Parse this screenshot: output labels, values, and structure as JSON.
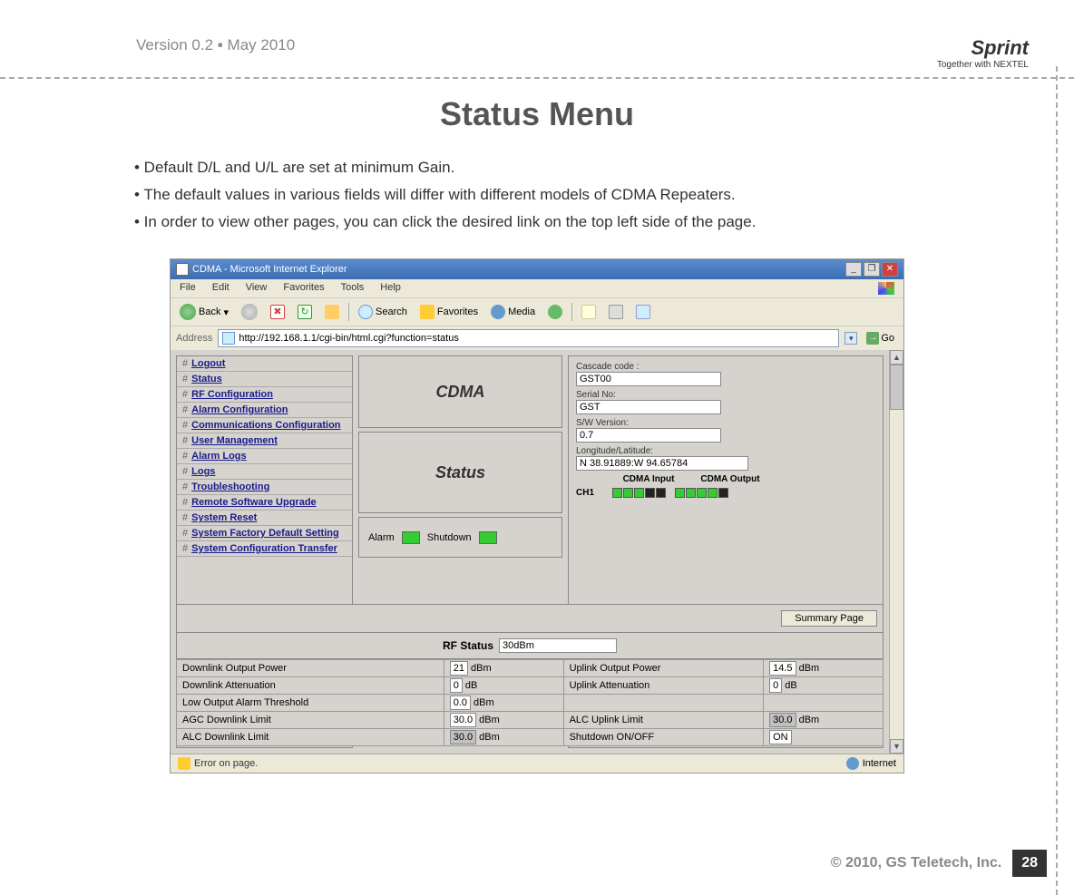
{
  "header": {
    "version": "Version 0.2 ▪ May 2010",
    "logo_main": "Sprint",
    "logo_sub": "Together with NEXTEL"
  },
  "title": "Status Menu",
  "bullets": [
    "• Default D/L and U/L are set at minimum Gain.",
    "• The default values in various fields will differ with different models of CDMA Repeaters.",
    "• In order to view other pages, you can click the desired link on the top left side of the page."
  ],
  "ie": {
    "title": "CDMA - Microsoft Internet Explorer",
    "menu": [
      "File",
      "Edit",
      "View",
      "Favorites",
      "Tools",
      "Help"
    ],
    "toolbar": {
      "back": "Back",
      "search": "Search",
      "favorites": "Favorites",
      "media": "Media"
    },
    "address_label": "Address",
    "address_url": "http://192.168.1.1/cgi-bin/html.cgi?function=status",
    "go": "Go",
    "status_left": "Error on page.",
    "status_right": "Internet"
  },
  "nav": [
    "Logout",
    "Status",
    "RF Configuration",
    "Alarm Configuration",
    "Communications Configuration",
    "User Management",
    "Alarm Logs",
    "Logs",
    "Troubleshooting",
    "Remote Software Upgrade",
    "System Reset",
    "System Factory Default Setting",
    "System Configuration Transfer"
  ],
  "mid": {
    "cdma": "CDMA",
    "status": "Status",
    "alarm_label": "Alarm",
    "shutdown_label": "Shutdown"
  },
  "info": {
    "cascade_label": "Cascade code :",
    "cascade_value": "GST00",
    "serial_label": "Serial No:",
    "serial_value": "GST",
    "sw_label": "S/W Version:",
    "sw_value": "0.7",
    "lonlat_label": "Longitude/Latitude:",
    "lonlat_value": "N 38.91889:W 94.65784",
    "cdma_input": "CDMA Input",
    "cdma_output": "CDMA Output",
    "ch1": "CH1"
  },
  "lower": {
    "summary_btn": "Summary Page",
    "rf_label": "RF Status",
    "rf_value": "30dBm",
    "rows": [
      {
        "l_label": "Downlink Output Power",
        "l_val": "21",
        "l_unit": "dBm",
        "r_label": "Uplink Output Power",
        "r_val": "14.5",
        "r_unit": "dBm"
      },
      {
        "l_label": "Downlink Attenuation",
        "l_val": "0",
        "l_unit": "dB",
        "r_label": "Uplink Attenuation",
        "r_val": "0",
        "r_unit": "dB"
      },
      {
        "l_label": "Low Output Alarm Threshold",
        "l_val": "0.0",
        "l_unit": "dBm",
        "r_label": "",
        "r_val": "",
        "r_unit": ""
      },
      {
        "l_label": "AGC Downlink Limit",
        "l_val": "30.0",
        "l_unit": "dBm",
        "r_label": "ALC Uplink Limit",
        "r_val": "30.0",
        "r_unit": "dBm",
        "r_gray": true
      },
      {
        "l_label": "ALC Downlink Limit",
        "l_val": "30.0",
        "l_unit": "dBm",
        "l_gray": true,
        "r_label": "Shutdown ON/OFF",
        "r_val": "ON",
        "r_unit": ""
      }
    ]
  },
  "footer": {
    "copyright": "© 2010, GS Teletech, Inc.",
    "page": "28"
  }
}
